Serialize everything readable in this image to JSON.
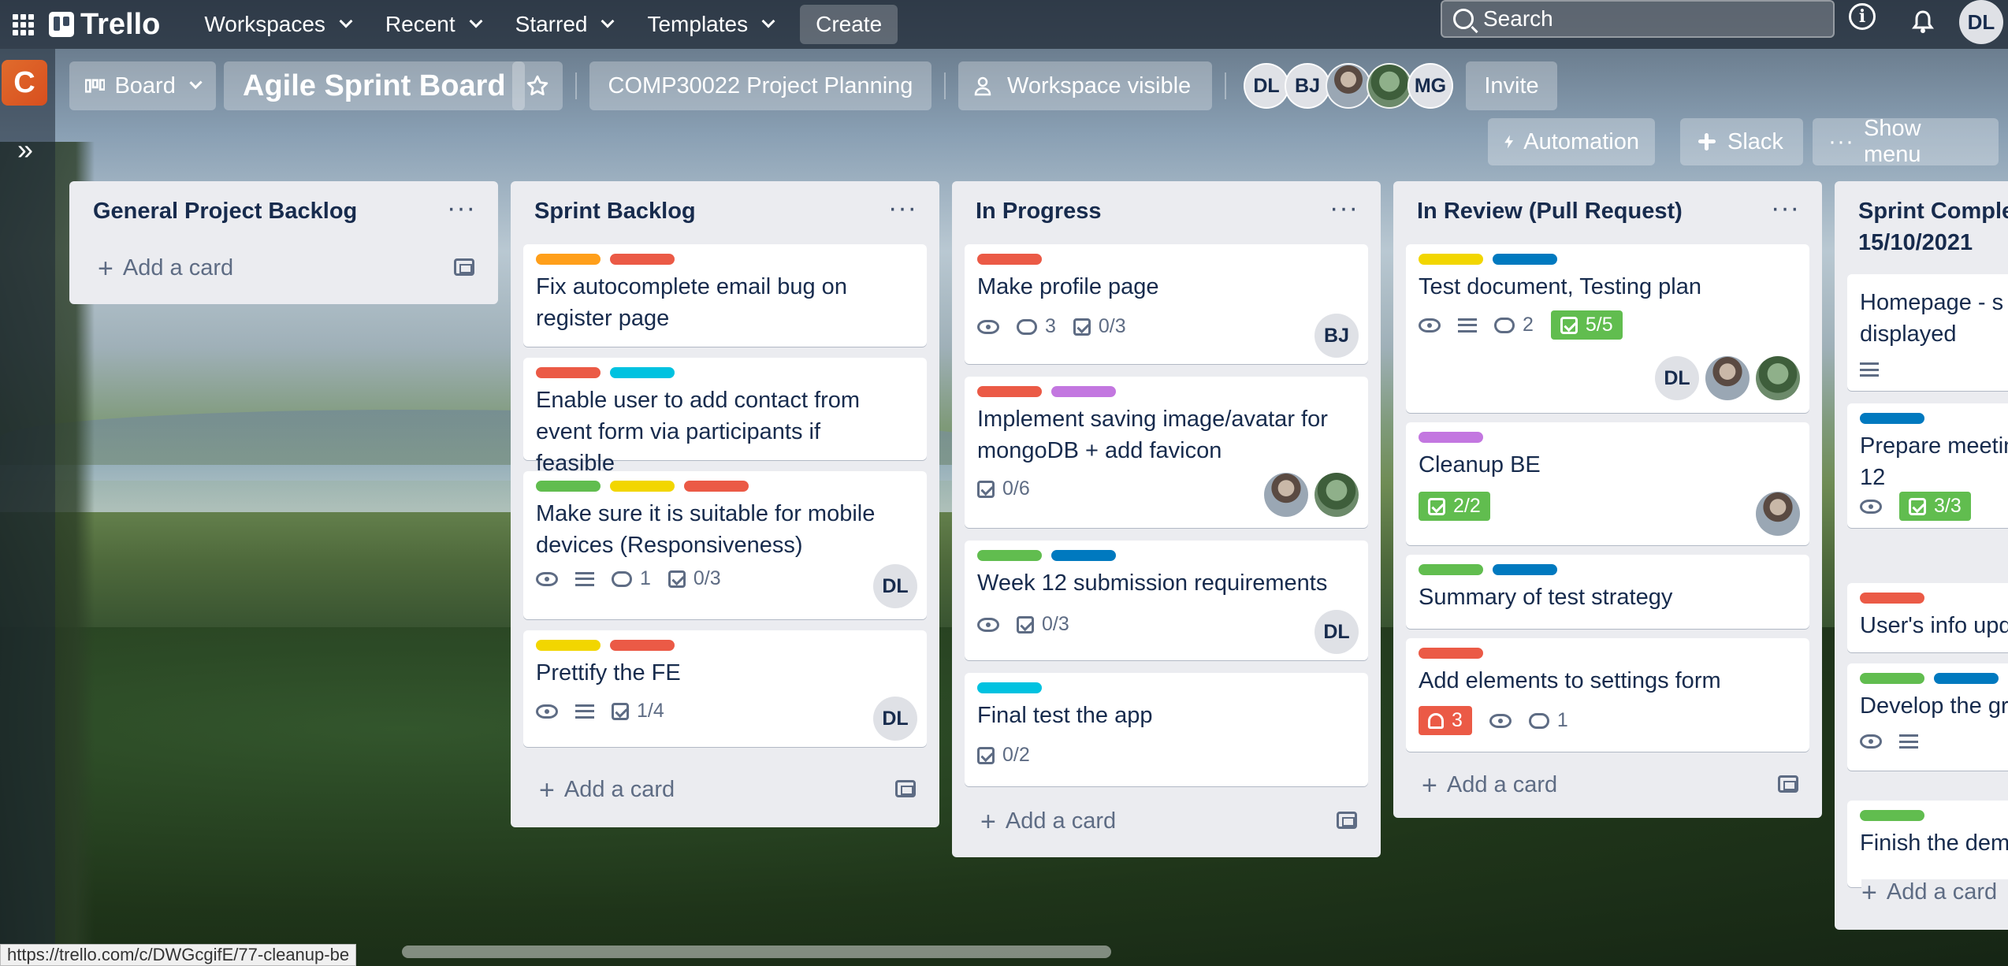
{
  "nav": {
    "logo": "Trello",
    "menus": [
      "Workspaces",
      "Recent",
      "Starred",
      "Templates"
    ],
    "create": "Create",
    "search_placeholder": "Search",
    "user_initials": "DL"
  },
  "workspace": {
    "initial": "C"
  },
  "board": {
    "view": "Board",
    "title": "Agile Sprint Board",
    "workspace_name": "COMP30022 Project Planning",
    "visibility": "Workspace visible",
    "members": [
      "DL",
      "BJ",
      "",
      "",
      "MG"
    ],
    "invite": "Invite",
    "automation": "Automation",
    "slack": "Slack",
    "show_menu": "Show menu"
  },
  "label_colors": {
    "orange": "#ff9f1a",
    "red": "#eb5a46",
    "cyan": "#00c2e0",
    "green": "#61bd4f",
    "yellow": "#f2d600",
    "blue": "#0079bf",
    "purple": "#c377e0",
    "pink": "#ff78cb"
  },
  "lists": [
    {
      "title": "General Project Backlog",
      "add_card": "Add a card",
      "cards": []
    },
    {
      "title": "Sprint Backlog",
      "add_card": "Add a card",
      "cards": [
        {
          "title": "Fix autocomplete email bug on register page"
        },
        {
          "title": "Enable user to add contact from event form via participants if feasible"
        },
        {
          "title": "Make sure it is suitable for mobile devices (Responsiveness)",
          "comments": "1",
          "checklist": "0/3",
          "member": "DL"
        },
        {
          "title": "Prettify the FE",
          "checklist": "1/4",
          "member": "DL"
        }
      ]
    },
    {
      "title": "In Progress",
      "add_card": "Add a card",
      "cards": [
        {
          "title": "Make profile page",
          "comments": "3",
          "checklist": "0/3",
          "member": "BJ"
        },
        {
          "title": "Implement saving image/avatar for mongoDB + add favicon",
          "checklist": "0/6"
        },
        {
          "title": "Week 12 submission requirements",
          "checklist": "0/3",
          "member": "DL"
        },
        {
          "title": "Final test the app",
          "checklist": "0/2"
        }
      ]
    },
    {
      "title": "In Review (Pull Request)",
      "add_card": "Add a card",
      "cards": [
        {
          "title": "Test document, Testing plan",
          "comments": "2",
          "checklist": "5/5",
          "member": "DL"
        },
        {
          "title": "Cleanup BE",
          "checklist": "2/2"
        },
        {
          "title": "Summary of test strategy"
        },
        {
          "title": "Add elements to settings form",
          "notifications": "3",
          "comments": "1"
        }
      ]
    },
    {
      "title": "Sprint Comple",
      "subtitle": "15/10/2021",
      "add_card": "Add a card",
      "cards": [
        {
          "title": "Homepage - s",
          "title2": "displayed"
        },
        {
          "title": "Prepare meetin",
          "title2": "12",
          "checklist": "3/3"
        },
        {
          "title": "User's info upd"
        },
        {
          "title": "Develop the gr"
        },
        {
          "title": "Finish the dem"
        }
      ]
    }
  ],
  "status_url": "https://trello.com/c/DWGcgifE/77-cleanup-be"
}
